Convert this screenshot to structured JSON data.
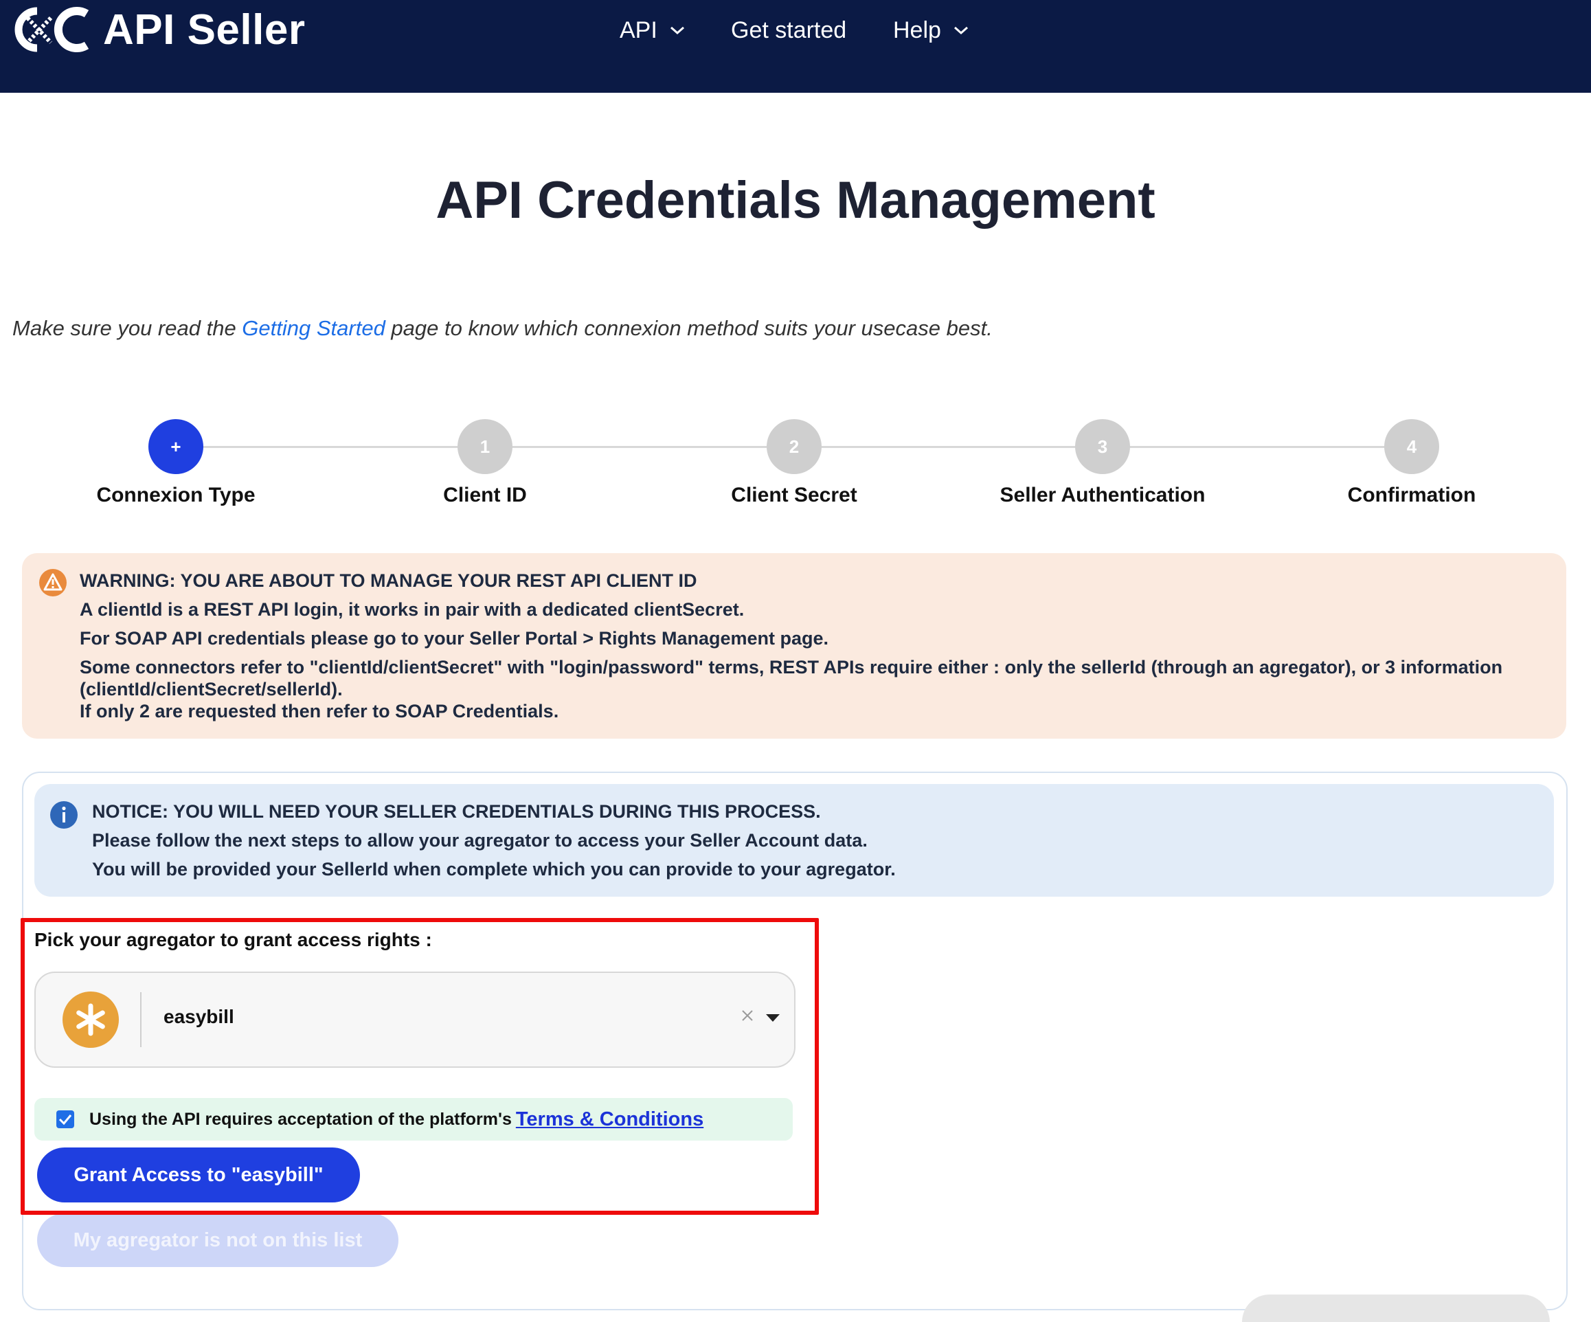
{
  "navbar": {
    "brand": "API Seller",
    "items": [
      {
        "label": "API",
        "has_dropdown": true
      },
      {
        "label": "Get started",
        "has_dropdown": false
      },
      {
        "label": "Help",
        "has_dropdown": true
      }
    ],
    "background": "#0b1a45"
  },
  "page": {
    "title": "API Credentials Management",
    "intro_before": "Make sure you read the ",
    "intro_link": "Getting Started",
    "intro_after": " page to know which connexion method suits your usecase best."
  },
  "stepper": {
    "steps": [
      {
        "badge": "+",
        "label": "Connexion Type",
        "active": true
      },
      {
        "badge": "1",
        "label": "Client ID",
        "active": false
      },
      {
        "badge": "2",
        "label": "Client Secret",
        "active": false
      },
      {
        "badge": "3",
        "label": "Seller Authentication",
        "active": false
      },
      {
        "badge": "4",
        "label": "Confirmation",
        "active": false
      }
    ]
  },
  "warning": {
    "heading": "WARNING: YOU ARE ABOUT TO MANAGE YOUR REST API CLIENT ID",
    "line1": "A clientId is a REST API login, it works in pair with a dedicated clientSecret.",
    "line2": "For SOAP API credentials please go to your Seller Portal > Rights Management page.",
    "line3": "Some connectors refer to \"clientId/clientSecret\" with \"login/password\" terms, REST APIs require either : only the sellerId (through an agregator), or 3 information (clientId/clientSecret/sellerId).",
    "line4": "If only 2 are requested then refer to SOAP Credentials."
  },
  "notice": {
    "heading": "NOTICE: YOU WILL NEED YOUR SELLER CREDENTIALS DURING THIS PROCESS.",
    "line1": "Please follow the next steps to allow your agregator to access your Seller Account data.",
    "line2": "You will be provided your SellerId when complete which you can provide to your agregator."
  },
  "aggregator": {
    "pick_label": "Pick your agregator to grant access rights :",
    "selected": "easybill",
    "logo_color": "#e8a23a",
    "terms_text": "Using the API requires acceptation of the platform's",
    "terms_link": "Terms & Conditions",
    "terms_checked": true,
    "grant_button": "Grant Access to \"easybill\"",
    "not_listed_button": "My agregator is not on this list"
  },
  "colors": {
    "primary": "#1f3fe0",
    "warning_bg": "#fbeadf",
    "notice_bg": "#e2ecf8",
    "highlight": "#ee0b0b"
  }
}
